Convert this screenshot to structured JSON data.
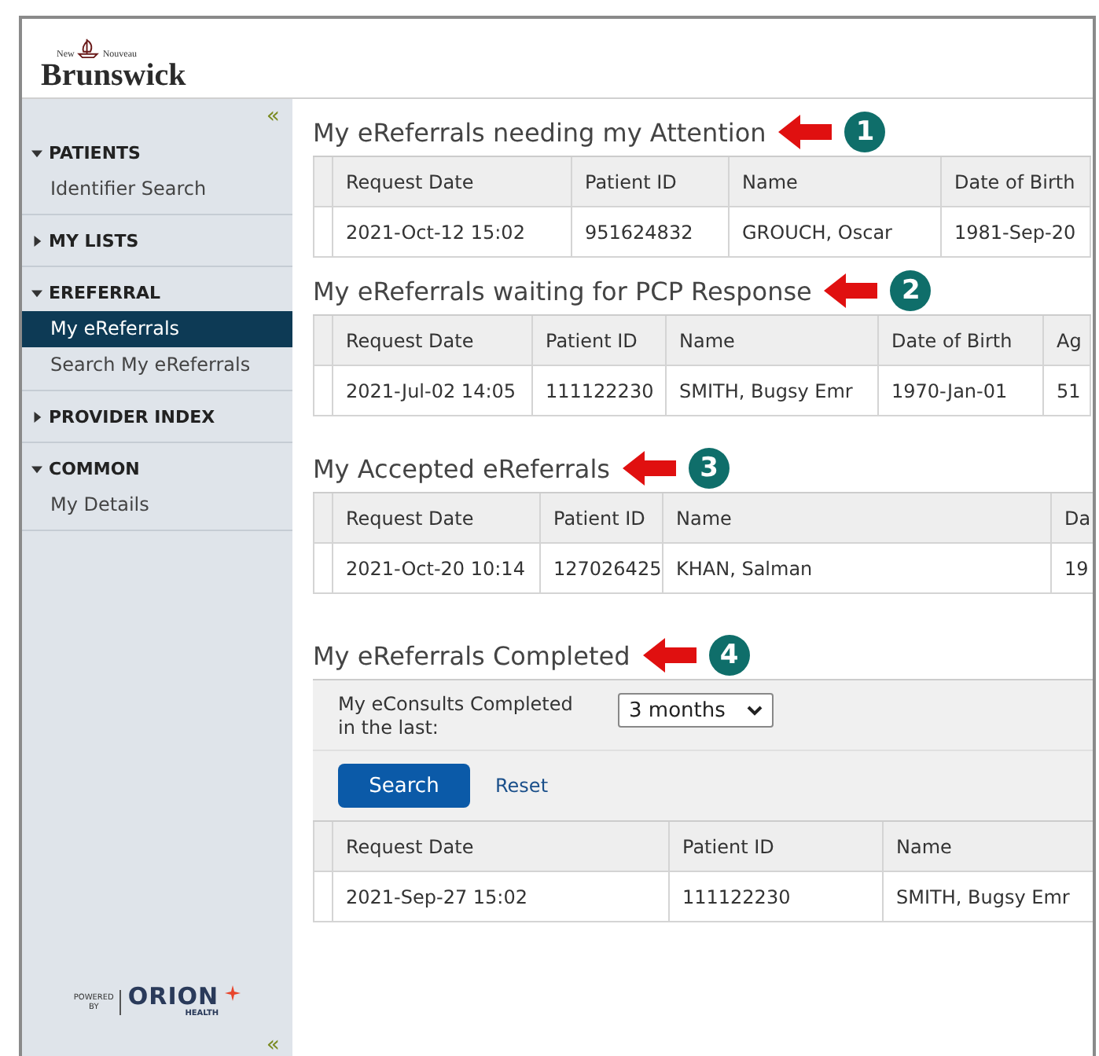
{
  "header": {
    "logo_small_left": "New",
    "logo_small_right": "Nouveau",
    "logo_name": "Brunswick"
  },
  "sidebar": {
    "collapse": "«",
    "sections": [
      {
        "title": "PATIENTS",
        "expanded": true,
        "items": [
          {
            "label": "Identifier Search",
            "selected": false
          }
        ]
      },
      {
        "title": "MY LISTS",
        "expanded": false
      },
      {
        "title": "EREFERRAL",
        "expanded": true,
        "items": [
          {
            "label": "My eReferrals",
            "selected": true
          },
          {
            "label": "Search My eReferrals",
            "selected": false
          }
        ]
      },
      {
        "title": "PROVIDER INDEX",
        "expanded": false
      },
      {
        "title": "COMMON",
        "expanded": true,
        "items": [
          {
            "label": "My Details",
            "selected": false
          }
        ]
      }
    ],
    "footer": {
      "powered": "POWERED",
      "by": "BY",
      "brand": "ORION",
      "brand_sub": "HEALTH",
      "collapse": "«"
    }
  },
  "sections": [
    {
      "title": "My eReferrals needing my Attention",
      "marker": "1",
      "columns": [
        "Request Date",
        "Patient ID",
        "Name",
        "Date of Birth"
      ],
      "rows": [
        [
          "2021-Oct-12 15:02",
          "951624832",
          "GROUCH, Oscar",
          "1981-Sep-20"
        ]
      ]
    },
    {
      "title": "My eReferrals waiting for PCP Response",
      "marker": "2",
      "columns": [
        "Request Date",
        "Patient ID",
        "Name",
        "Date of Birth",
        "Ag"
      ],
      "rows": [
        [
          "2021-Jul-02 14:05",
          "111122230",
          "SMITH, Bugsy Emr",
          "1970-Jan-01",
          "51"
        ]
      ]
    },
    {
      "title": "My Accepted eReferrals",
      "marker": "3",
      "columns": [
        "Request Date",
        "Patient ID",
        "Name",
        "Da"
      ],
      "rows": [
        [
          "2021-Oct-20 10:14",
          "127026425",
          "KHAN, Salman",
          "19"
        ]
      ]
    },
    {
      "title": "My eReferrals Completed",
      "marker": "4",
      "filter": {
        "label": "My eConsults Completed in the last:",
        "value": "3 months",
        "search": "Search",
        "reset": "Reset"
      },
      "columns": [
        "Request Date",
        "Patient ID",
        "Name"
      ],
      "rows": [
        [
          "2021-Sep-27 15:02",
          "111122230",
          "SMITH, Bugsy Emr"
        ]
      ]
    }
  ]
}
